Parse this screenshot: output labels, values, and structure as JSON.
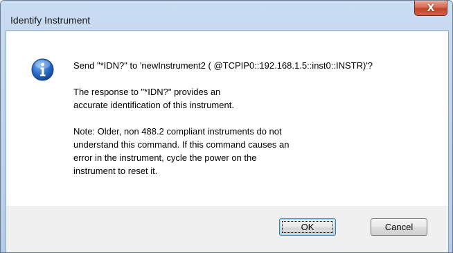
{
  "window": {
    "title": "Identify Instrument",
    "close_glyph": "X"
  },
  "dialog": {
    "icon": "info-icon",
    "message": "Send \"*IDN?\" to 'newInstrument2 ( @TCPIP0::192.168.1.5::inst0::INSTR)'?",
    "response_text": "The response to \"*IDN?\" provides an\naccurate identification of this instrument.",
    "note_text": "Note: Older, non 488.2 compliant instruments do not\nunderstand this command. If this command causes an\nerror in the instrument, cycle the power on the\ninstrument to reset it."
  },
  "buttons": {
    "ok_label": "OK",
    "cancel_label": "Cancel"
  },
  "colors": {
    "title_bar": "#bcd2ec",
    "close_button": "#c2432a",
    "info_icon": "#1e5fb4",
    "button_bar": "#f0f0f0"
  }
}
